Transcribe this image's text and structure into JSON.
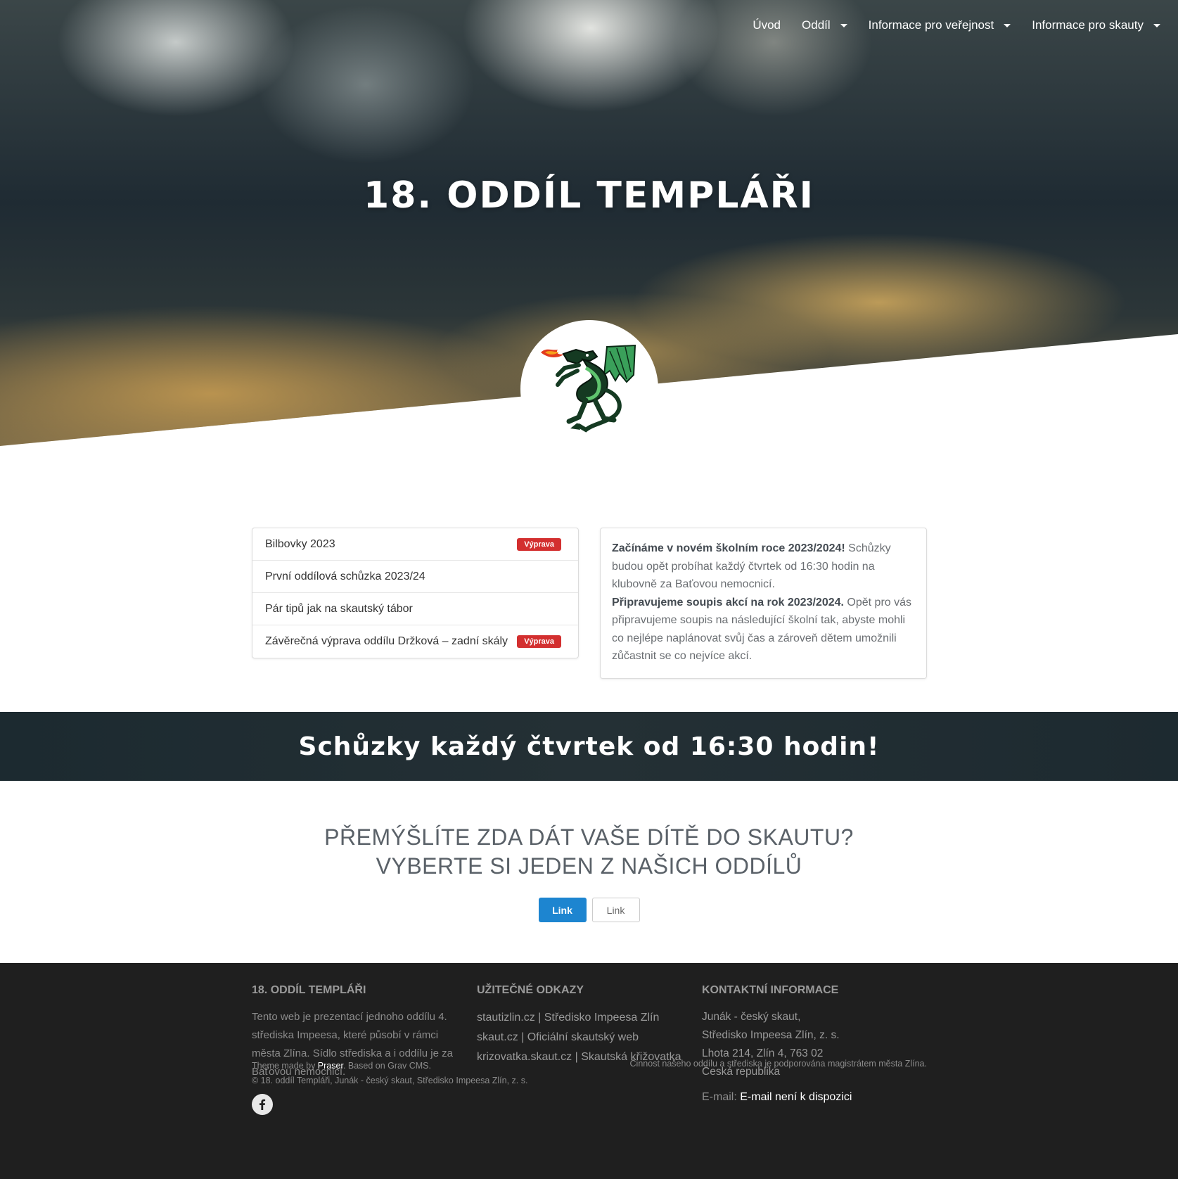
{
  "nav": {
    "items": [
      {
        "label": "Úvod",
        "dropdown": false
      },
      {
        "label": "Oddíl",
        "dropdown": true
      },
      {
        "label": "Informace pro veřejnost",
        "dropdown": true
      },
      {
        "label": "Informace pro skauty",
        "dropdown": true
      }
    ]
  },
  "hero": {
    "title": "18. ODDÍL TEMPLÁŘI",
    "logo_icon": "dragon-logo"
  },
  "news": {
    "items": [
      {
        "title": "Bilbovky 2023",
        "badge": "Výprava"
      },
      {
        "title": "První oddílová schůzka 2023/24",
        "badge": ""
      },
      {
        "title": "Pár tipů jak na skautský tábor",
        "badge": ""
      },
      {
        "title": "Závěrečná výprava oddílu Držková – zadní skály",
        "badge": "Výprava"
      }
    ]
  },
  "info": {
    "p1_bold": "Začínáme v novém školním roce 2023/2024!",
    "p1_text": " Schůzky budou opět probíhat každý čtvrtek od 16:30 hodin na klubovně za Baťovou nemocnicí.",
    "p2_bold": "Připravujeme soupis akcí na rok 2023/2024.",
    "p2_text": " Opět pro vás připravujeme soupis na následující školní tak, abyste mohli co nejlépe naplánovat svůj čas a zároveň dětem umožnili zůčastnit se co nejvíce akcí."
  },
  "band": {
    "text": "Schůzky každý čtvrtek od 16:30 hodin!"
  },
  "cta": {
    "line1": "PŘEMÝŠLÍTE ZDA DÁT VAŠE DÍTĚ DO SKAUTU?",
    "line2": "VYBERTE SI JEDEN Z NAŠICH ODDÍLŮ",
    "button_primary": "Link",
    "button_secondary": "Link"
  },
  "footer": {
    "col1": {
      "heading": "18. ODDÍL TEMPLÁŘI",
      "text": "Tento web je prezentací jednoho oddílu 4. střediska Impeesa, které působí v rámci města Zlína. Sídlo střediska a i oddílu je za Baťovou nemocnicí.",
      "social_icon": "facebook-icon"
    },
    "col2": {
      "heading": "UŽITEČNÉ ODKAZY",
      "links": [
        "stautizlin.cz | Středisko Impeesa Zlín",
        "skaut.cz | Oficiální skautský web",
        "krizovatka.skaut.cz | Skautská křižovatka"
      ]
    },
    "col3": {
      "heading": "KONTAKTNÍ INFORMACE",
      "address": [
        "Junák - český skaut,",
        "Středisko Impeesa Zlín, z. s.",
        "Lhota 214, Zlín 4, 763 02",
        "Česká republika"
      ],
      "email_label": "E-mail:",
      "email_value": "E-mail není k dispozici"
    },
    "bottom": {
      "theme_prefix": "Theme made by ",
      "theme_author": "Praser",
      "theme_suffix": ". Based on Grav CMS.",
      "copyright": "© 18. oddíl Templáři, Junák - český skaut, Středisko Impeesa Zlín, z. s.",
      "support": "Činnost našeho oddílu a střediska je podporována magistrátem města Zlína."
    }
  },
  "colors": {
    "badge": "#d32f2f",
    "primary_button": "#1d85d0",
    "footer_bg": "#1f1f1f",
    "band_bg": "#243035"
  }
}
